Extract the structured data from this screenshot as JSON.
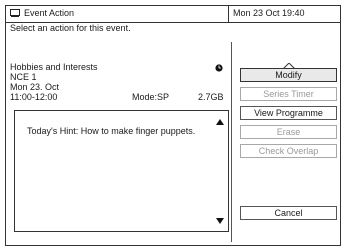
{
  "header": {
    "title": "Event Action",
    "datetime": "Mon 23 Oct   19:40"
  },
  "prompt": "Select an action for this event.",
  "event": {
    "name": "Hobbies and Interests",
    "channel": "NCE 1",
    "date": "Mon 23. Oct",
    "time": "11:00-12:00",
    "mode": "Mode:SP",
    "size": "2.7GB"
  },
  "hint": "Today's Hint: How to make finger puppets.",
  "buttons": {
    "modify": "Modify",
    "series_timer": "Series Timer",
    "view_programme": "View Programme",
    "erase": "Erase",
    "check_overlap": "Check Overlap",
    "cancel": "Cancel"
  },
  "colors": {
    "disabled": "#9a9a9a",
    "border": "#333333"
  }
}
